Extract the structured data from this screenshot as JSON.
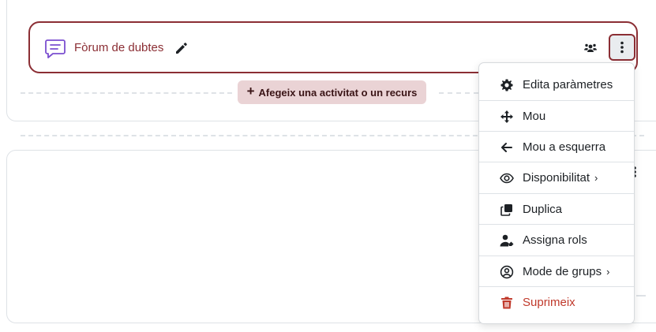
{
  "activity": {
    "title": "Fòrum de dubtes"
  },
  "add_activity": {
    "plus": "+",
    "label": "Afegeix una activitat o un recurs"
  },
  "colors": {
    "accent": "#8b2e34",
    "danger": "#c0392b",
    "forum_icon": "#7b4fd0",
    "add_button_bg": "#ead3d5"
  },
  "menu": {
    "items": [
      {
        "label": "Edita paràmetres",
        "icon": "gear-icon"
      },
      {
        "label": "Mou",
        "icon": "move-arrows-icon"
      },
      {
        "label": "Mou a esquerra",
        "icon": "arrow-left-icon"
      },
      {
        "label": "Disponibilitat",
        "icon": "eye-icon",
        "chevron": "›"
      },
      {
        "label": "Duplica",
        "icon": "copy-icon"
      },
      {
        "label": "Assigna rols",
        "icon": "user-role-icon"
      },
      {
        "label": "Mode de grups",
        "icon": "user-circle-icon",
        "chevron": "›"
      },
      {
        "label": "Suprimeix",
        "icon": "trash-icon"
      }
    ]
  }
}
